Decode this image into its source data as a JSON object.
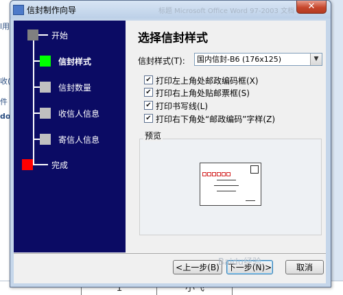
{
  "background": {
    "left_fragments": [
      "l用",
      "收(",
      "件",
      "do"
    ],
    "bottom_cells": [
      "1",
      "小飞"
    ],
    "obscured_title": "标题 Microsoft Office Word 97-2003 文档"
  },
  "window": {
    "title": "信封制作向导",
    "close_glyph": "✕"
  },
  "nav": {
    "steps": [
      {
        "label": "开始",
        "color": "#808080",
        "current": false
      },
      {
        "label": "信封样式",
        "color": "#00ff00",
        "current": true
      },
      {
        "label": "信封数量",
        "color": "#c0c0c0",
        "current": false
      },
      {
        "label": "收信人信息",
        "color": "#c0c0c0",
        "current": false
      },
      {
        "label": "寄信人信息",
        "color": "#c0c0c0",
        "current": false
      },
      {
        "label": "完成",
        "color": "#ff0000",
        "current": false
      }
    ]
  },
  "content": {
    "heading": "选择信封样式",
    "style_label": "信封样式(T):",
    "style_value": "国内信封-B6 (176x125)",
    "checkboxes": [
      {
        "label": "打印左上角处邮政编码框(X)",
        "checked": true
      },
      {
        "label": "打印右上角处贴邮票框(S)",
        "checked": true
      },
      {
        "label": "打印书写线(L)",
        "checked": true
      },
      {
        "label": "打印右下角处“邮政编码”字样(Z)",
        "checked": true
      }
    ],
    "preview_label": "预览"
  },
  "buttons": {
    "back": "<上一步(B)",
    "next": "下一步(N)>",
    "cancel": "取消"
  },
  "watermark": "Baidu经验"
}
